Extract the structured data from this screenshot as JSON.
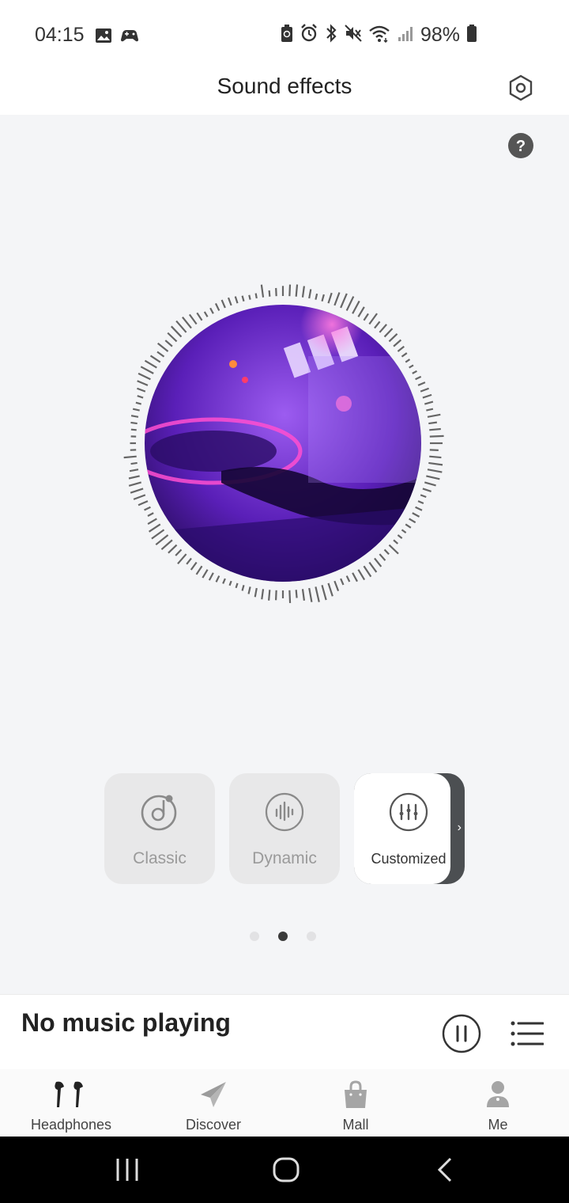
{
  "status_bar": {
    "time": "04:15",
    "battery": "98%",
    "left_icons": [
      "gallery-icon",
      "game-controller-icon"
    ],
    "right_icons": [
      "battery-saver-icon",
      "alarm-icon",
      "bluetooth-icon",
      "mute-icon",
      "wifi-icon",
      "signal-icon",
      "battery-icon"
    ]
  },
  "header": {
    "title": "Sound effects",
    "settings_icon": "hexagon-settings-icon",
    "help_icon": "question-circle-icon"
  },
  "visualizer": {
    "image": "dj-turntable-artwork"
  },
  "modes": [
    {
      "label": "Classic",
      "icon": "music-note-icon",
      "selected": false
    },
    {
      "label": "Dynamic",
      "icon": "waveform-icon",
      "selected": false
    },
    {
      "label": "Customized",
      "icon": "equalizer-icon",
      "selected": true
    }
  ],
  "pager": {
    "count": 3,
    "active": 1
  },
  "now_playing": {
    "title": "No music playing",
    "pause_icon": "pause-icon",
    "playlist_icon": "playlist-icon"
  },
  "bottom_nav": [
    {
      "label": "Headphones",
      "icon": "earbuds-icon",
      "active": true
    },
    {
      "label": "Discover",
      "icon": "paper-plane-icon",
      "active": false
    },
    {
      "label": "Mall",
      "icon": "shopping-bag-icon",
      "active": false
    },
    {
      "label": "Me",
      "icon": "person-icon",
      "active": false
    }
  ],
  "colors": {
    "background": "#f4f5f7",
    "card": "#e8e8e9",
    "accent_dark": "#4c4f52",
    "artwork_purple": "#5a1fb8"
  }
}
